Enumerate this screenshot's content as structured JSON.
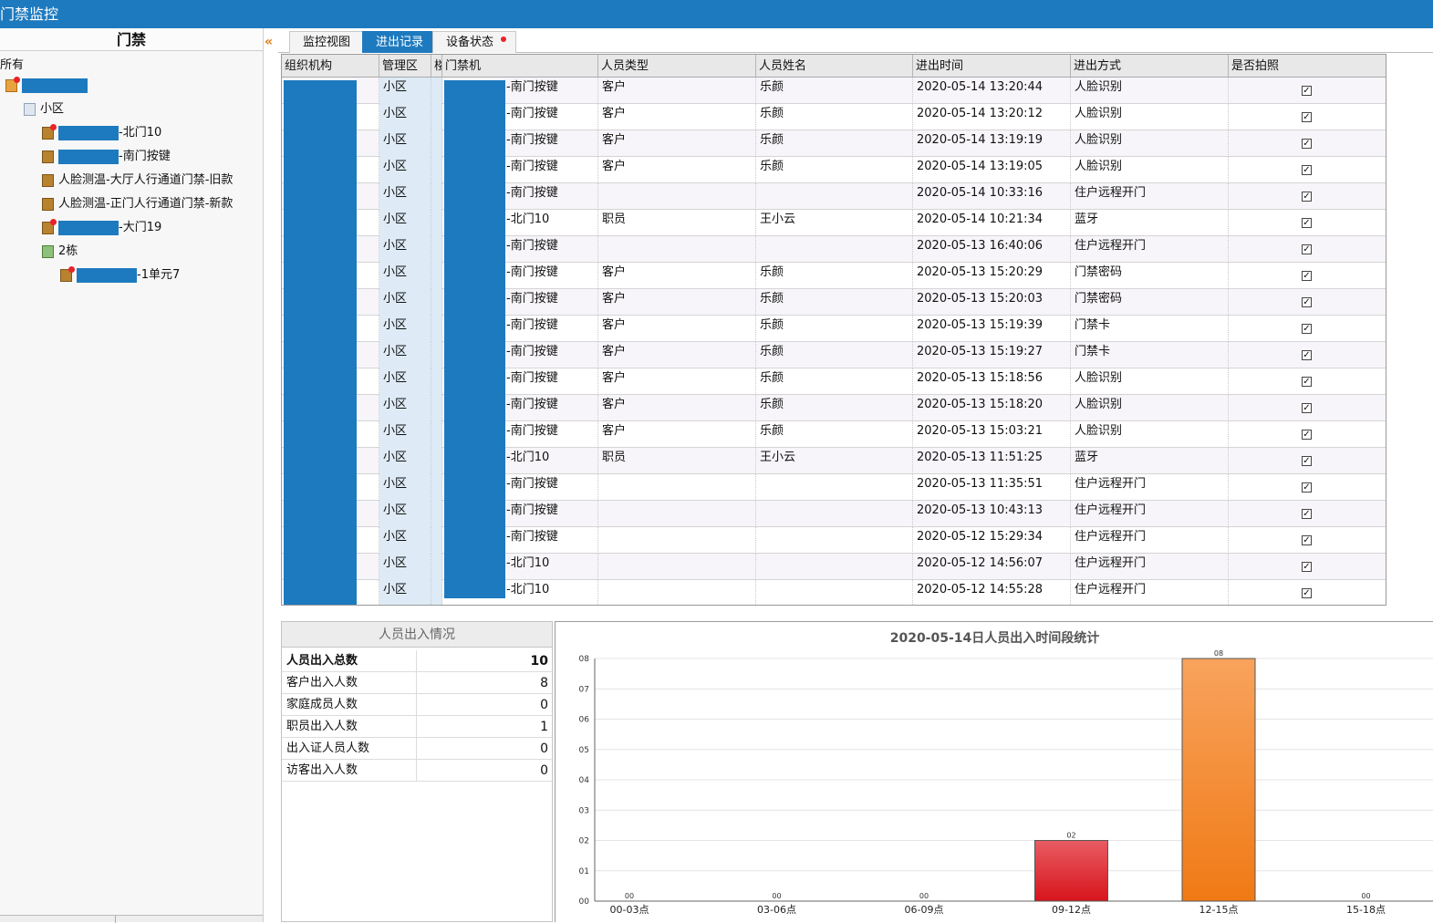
{
  "window": {
    "title": "门禁监控"
  },
  "sidebar": {
    "header": "门禁",
    "collapse_glyph": "«",
    "root_label": "所有",
    "items": [
      {
        "suffix": "",
        "icon": "home-icon",
        "indent": 0,
        "redacted": true
      },
      {
        "suffix": "小区",
        "icon": "folder-icon",
        "indent": 1,
        "redacted": false
      },
      {
        "suffix": "-北门10",
        "icon": "door-alert-icon",
        "indent": 2,
        "redacted": true
      },
      {
        "suffix": "-南门按键",
        "icon": "door-icon",
        "indent": 2,
        "redacted": true
      },
      {
        "suffix": "人脸测温-大厅人行通道门禁-旧款",
        "icon": "door-icon",
        "indent": 2,
        "redacted": false
      },
      {
        "suffix": "人脸测温-正门人行通道门禁-新款",
        "icon": "door-icon",
        "indent": 2,
        "redacted": false
      },
      {
        "suffix": "-大门19",
        "icon": "door-alert-icon",
        "indent": 2,
        "redacted": true
      },
      {
        "suffix": "2栋",
        "icon": "building-icon",
        "indent": 2,
        "redacted": false
      },
      {
        "suffix": "-1单元7",
        "icon": "door-alert-icon",
        "indent": 3,
        "redacted": true
      }
    ]
  },
  "tabs": [
    {
      "label": "监控视图",
      "active": false,
      "dot": false
    },
    {
      "label": "进出记录",
      "active": true,
      "dot": false
    },
    {
      "label": "设备状态",
      "active": false,
      "dot": true
    }
  ],
  "table": {
    "columns": [
      "组织机构",
      "管理区",
      "楼",
      "门禁机",
      "人员类型",
      "人员姓名",
      "进出时间",
      "进出方式",
      "是否拍照"
    ],
    "rows": [
      {
        "mgr": "小区",
        "device": "-南门按键",
        "type": "客户",
        "name": "乐颜",
        "time": "2020-05-14 13:20:44",
        "method": "人脸识别",
        "photo": "✓"
      },
      {
        "mgr": "小区",
        "device": "-南门按键",
        "type": "客户",
        "name": "乐颜",
        "time": "2020-05-14 13:20:12",
        "method": "人脸识别",
        "photo": "✓"
      },
      {
        "mgr": "小区",
        "device": "-南门按键",
        "type": "客户",
        "name": "乐颜",
        "time": "2020-05-14 13:19:19",
        "method": "人脸识别",
        "photo": "✓"
      },
      {
        "mgr": "小区",
        "device": "-南门按键",
        "type": "客户",
        "name": "乐颜",
        "time": "2020-05-14 13:19:05",
        "method": "人脸识别",
        "photo": "✓"
      },
      {
        "mgr": "小区",
        "device": "-南门按键",
        "type": "",
        "name": "",
        "time": "2020-05-14 10:33:16",
        "method": "住户远程开门",
        "photo": "✓"
      },
      {
        "mgr": "小区",
        "device": "-北门10",
        "type": "职员",
        "name": "王小云",
        "time": "2020-05-14 10:21:34",
        "method": "蓝牙",
        "photo": "✓"
      },
      {
        "mgr": "小区",
        "device": "-南门按键",
        "type": "",
        "name": "",
        "time": "2020-05-13 16:40:06",
        "method": "住户远程开门",
        "photo": "✓"
      },
      {
        "mgr": "小区",
        "device": "-南门按键",
        "type": "客户",
        "name": "乐颜",
        "time": "2020-05-13 15:20:29",
        "method": "门禁密码",
        "photo": "✓"
      },
      {
        "mgr": "小区",
        "device": "-南门按键",
        "type": "客户",
        "name": "乐颜",
        "time": "2020-05-13 15:20:03",
        "method": "门禁密码",
        "photo": "✓"
      },
      {
        "mgr": "小区",
        "device": "-南门按键",
        "type": "客户",
        "name": "乐颜",
        "time": "2020-05-13 15:19:39",
        "method": "门禁卡",
        "photo": "✓"
      },
      {
        "mgr": "小区",
        "device": "-南门按键",
        "type": "客户",
        "name": "乐颜",
        "time": "2020-05-13 15:19:27",
        "method": "门禁卡",
        "photo": "✓"
      },
      {
        "mgr": "小区",
        "device": "-南门按键",
        "type": "客户",
        "name": "乐颜",
        "time": "2020-05-13 15:18:56",
        "method": "人脸识别",
        "photo": "✓"
      },
      {
        "mgr": "小区",
        "device": "-南门按键",
        "type": "客户",
        "name": "乐颜",
        "time": "2020-05-13 15:18:20",
        "method": "人脸识别",
        "photo": "✓"
      },
      {
        "mgr": "小区",
        "device": "-南门按键",
        "type": "客户",
        "name": "乐颜",
        "time": "2020-05-13 15:03:21",
        "method": "人脸识别",
        "photo": "✓"
      },
      {
        "mgr": "小区",
        "device": "-北门10",
        "type": "职员",
        "name": "王小云",
        "time": "2020-05-13 11:51:25",
        "method": "蓝牙",
        "photo": "✓"
      },
      {
        "mgr": "小区",
        "device": "-南门按键",
        "type": "",
        "name": "",
        "time": "2020-05-13 11:35:51",
        "method": "住户远程开门",
        "photo": "✓"
      },
      {
        "mgr": "小区",
        "device": "-南门按键",
        "type": "",
        "name": "",
        "time": "2020-05-13 10:43:13",
        "method": "住户远程开门",
        "photo": "✓"
      },
      {
        "mgr": "小区",
        "device": "-南门按键",
        "type": "",
        "name": "",
        "time": "2020-05-12 15:29:34",
        "method": "住户远程开门",
        "photo": "✓"
      },
      {
        "mgr": "小区",
        "device": "-北门10",
        "type": "",
        "name": "",
        "time": "2020-05-12 14:56:07",
        "method": "住户远程开门",
        "photo": "✓"
      },
      {
        "mgr": "小区",
        "device": "-北门10",
        "type": "",
        "name": "",
        "time": "2020-05-12 14:55:28",
        "method": "住户远程开门",
        "photo": "✓"
      }
    ]
  },
  "stats": {
    "title": "人员出入情况",
    "rows": [
      {
        "label": "人员出入总数",
        "value": "10",
        "bold": true
      },
      {
        "label": "客户出入人数",
        "value": "8",
        "bold": false
      },
      {
        "label": "家庭成员人数",
        "value": "0",
        "bold": false
      },
      {
        "label": "职员出入人数",
        "value": "1",
        "bold": false
      },
      {
        "label": "出入证人员人数",
        "value": "0",
        "bold": false
      },
      {
        "label": "访客出入人数",
        "value": "0",
        "bold": false
      }
    ]
  },
  "chart_data": {
    "type": "bar",
    "title": "2020-05-14日人员出入时间段统计",
    "categories": [
      "00-03点",
      "03-06点",
      "06-09点",
      "09-12点",
      "12-15点",
      "15-18点"
    ],
    "values": [
      0,
      0,
      0,
      2,
      8,
      0
    ],
    "value_labels": [
      "00",
      "00",
      "00",
      "02",
      "08",
      "00"
    ],
    "yticks": [
      "00",
      "01",
      "02",
      "03",
      "04",
      "05",
      "06",
      "07",
      "08"
    ],
    "ylim": [
      0,
      8
    ],
    "grid": true,
    "bar_colors": {
      "09-12点": "#d7141c",
      "12-15点": "#f07a15"
    }
  },
  "colors": {
    "accent": "#1e7abf",
    "alert_dot": "#e8232a"
  }
}
